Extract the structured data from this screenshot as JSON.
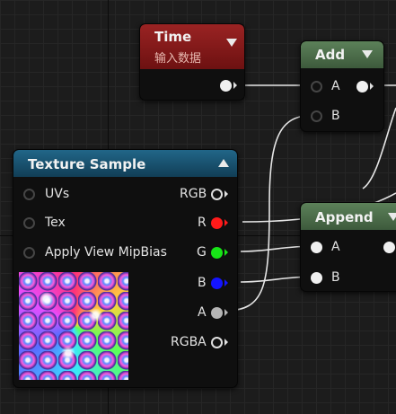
{
  "colors": {
    "background": "#1c1c1c",
    "time_header": "#8a1a1a",
    "math_header": "#4b6e4a",
    "texture_header": "#1b5470",
    "node_body": "#0f0f0f",
    "pin_r": "#ff1a1a",
    "pin_g": "#17e417",
    "pin_b": "#1414ff",
    "pin_a": "#b5b5b5",
    "wire": "#e6e6e6"
  },
  "nodes": {
    "time": {
      "title": "Time",
      "subtitle": "输入数据",
      "collapse_icon": "chevron-down-icon"
    },
    "add": {
      "title": "Add",
      "collapse_icon": "chevron-down-icon",
      "inputs": [
        "A",
        "B"
      ]
    },
    "append": {
      "title": "Append",
      "collapse_icon": "chevron-down-icon",
      "inputs": [
        "A",
        "B"
      ]
    },
    "texture_sample": {
      "title": "Texture Sample",
      "collapse_icon": "chevron-up-icon",
      "inputs": [
        "UVs",
        "Tex",
        "Apply View MipBias"
      ],
      "outputs": [
        "RGB",
        "R",
        "G",
        "B",
        "A",
        "RGBA"
      ],
      "preview_icon": "texture-preview"
    }
  }
}
